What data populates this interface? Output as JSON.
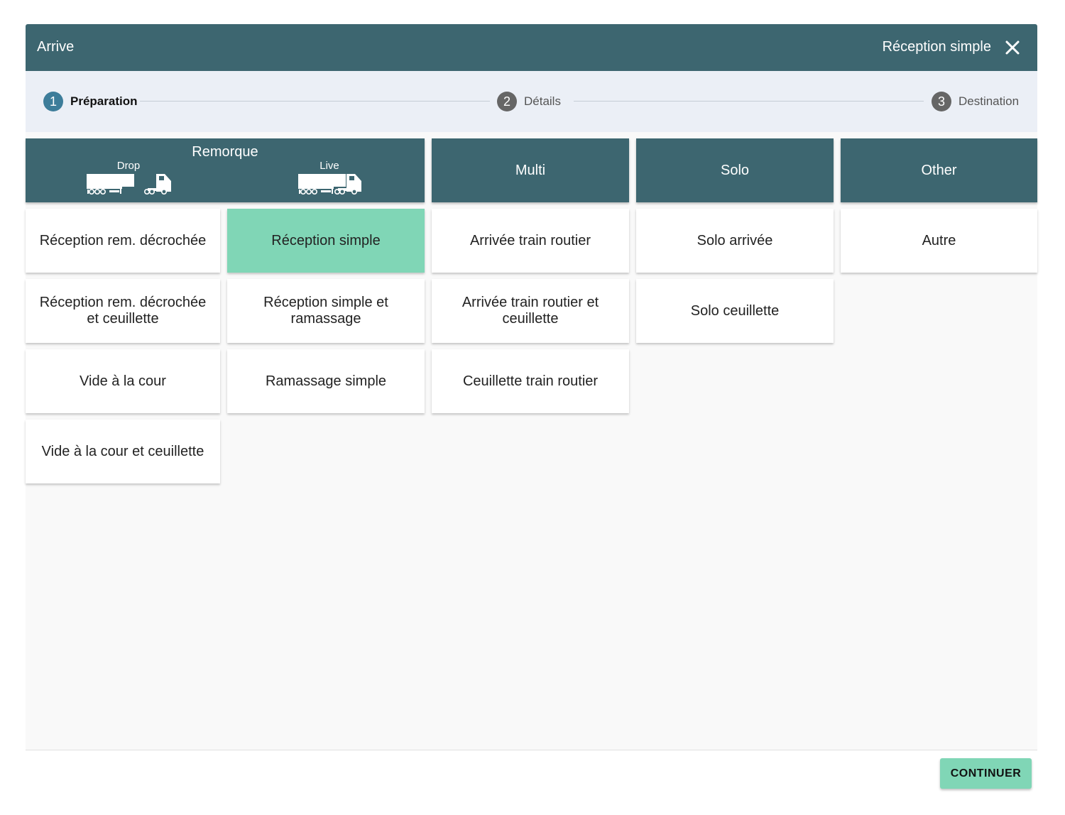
{
  "header": {
    "title": "Arrive",
    "subtitle": "Réception simple",
    "close_icon": "close-icon"
  },
  "stepper": {
    "steps": [
      {
        "number": "1",
        "label": "Préparation",
        "active": true
      },
      {
        "number": "2",
        "label": "Détails",
        "active": false
      },
      {
        "number": "3",
        "label": "Destination",
        "active": false
      }
    ]
  },
  "columns": {
    "remorque": {
      "label": "Remorque",
      "drop_label": "Drop",
      "live_label": "Live"
    },
    "multi": {
      "label": "Multi"
    },
    "solo": {
      "label": "Solo"
    },
    "other": {
      "label": "Other"
    }
  },
  "options": {
    "remorque": [
      "Réception rem. décrochée",
      "Réception rem. décrochée et ceuillette",
      "Vide à la cour",
      "Vide à la cour et ceuillette"
    ],
    "live": [
      "Réception simple",
      "Réception simple et ramassage",
      "Ramassage simple"
    ],
    "multi": [
      "Arrivée train routier",
      "Arrivée train routier et ceuillette",
      "Ceuillette train routier"
    ],
    "solo": [
      "Solo arrivée",
      "Solo ceuillette"
    ],
    "other": [
      "Autre"
    ]
  },
  "selected_option": "Réception simple",
  "colors": {
    "header": "#3d6670",
    "selected": "#80d6b6",
    "step_active": "#3d7d9a"
  },
  "footer": {
    "continue_label": "CONTINUER"
  }
}
